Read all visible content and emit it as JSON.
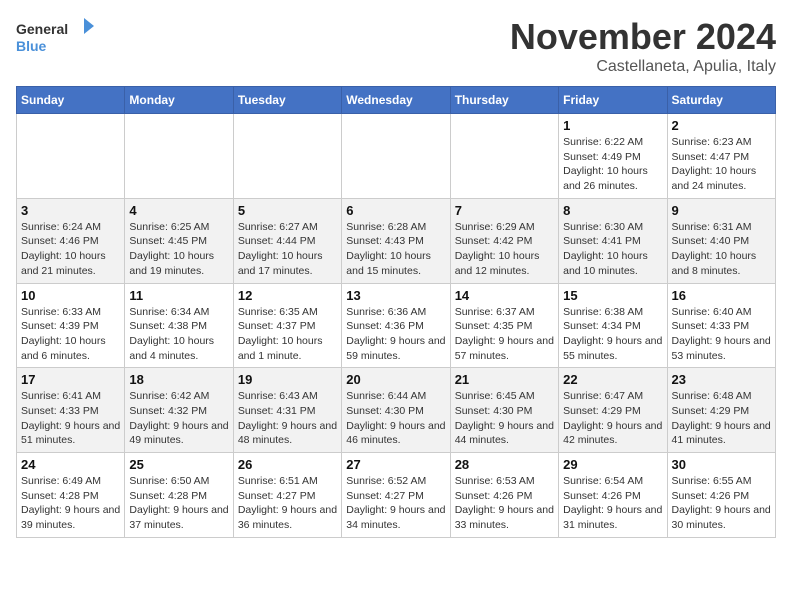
{
  "logo": {
    "general": "General",
    "blue": "Blue"
  },
  "title": "November 2024",
  "location": "Castellaneta, Apulia, Italy",
  "days_header": [
    "Sunday",
    "Monday",
    "Tuesday",
    "Wednesday",
    "Thursday",
    "Friday",
    "Saturday"
  ],
  "weeks": [
    [
      {
        "day": "",
        "info": ""
      },
      {
        "day": "",
        "info": ""
      },
      {
        "day": "",
        "info": ""
      },
      {
        "day": "",
        "info": ""
      },
      {
        "day": "",
        "info": ""
      },
      {
        "day": "1",
        "info": "Sunrise: 6:22 AM\nSunset: 4:49 PM\nDaylight: 10 hours and 26 minutes."
      },
      {
        "day": "2",
        "info": "Sunrise: 6:23 AM\nSunset: 4:47 PM\nDaylight: 10 hours and 24 minutes."
      }
    ],
    [
      {
        "day": "3",
        "info": "Sunrise: 6:24 AM\nSunset: 4:46 PM\nDaylight: 10 hours and 21 minutes."
      },
      {
        "day": "4",
        "info": "Sunrise: 6:25 AM\nSunset: 4:45 PM\nDaylight: 10 hours and 19 minutes."
      },
      {
        "day": "5",
        "info": "Sunrise: 6:27 AM\nSunset: 4:44 PM\nDaylight: 10 hours and 17 minutes."
      },
      {
        "day": "6",
        "info": "Sunrise: 6:28 AM\nSunset: 4:43 PM\nDaylight: 10 hours and 15 minutes."
      },
      {
        "day": "7",
        "info": "Sunrise: 6:29 AM\nSunset: 4:42 PM\nDaylight: 10 hours and 12 minutes."
      },
      {
        "day": "8",
        "info": "Sunrise: 6:30 AM\nSunset: 4:41 PM\nDaylight: 10 hours and 10 minutes."
      },
      {
        "day": "9",
        "info": "Sunrise: 6:31 AM\nSunset: 4:40 PM\nDaylight: 10 hours and 8 minutes."
      }
    ],
    [
      {
        "day": "10",
        "info": "Sunrise: 6:33 AM\nSunset: 4:39 PM\nDaylight: 10 hours and 6 minutes."
      },
      {
        "day": "11",
        "info": "Sunrise: 6:34 AM\nSunset: 4:38 PM\nDaylight: 10 hours and 4 minutes."
      },
      {
        "day": "12",
        "info": "Sunrise: 6:35 AM\nSunset: 4:37 PM\nDaylight: 10 hours and 1 minute."
      },
      {
        "day": "13",
        "info": "Sunrise: 6:36 AM\nSunset: 4:36 PM\nDaylight: 9 hours and 59 minutes."
      },
      {
        "day": "14",
        "info": "Sunrise: 6:37 AM\nSunset: 4:35 PM\nDaylight: 9 hours and 57 minutes."
      },
      {
        "day": "15",
        "info": "Sunrise: 6:38 AM\nSunset: 4:34 PM\nDaylight: 9 hours and 55 minutes."
      },
      {
        "day": "16",
        "info": "Sunrise: 6:40 AM\nSunset: 4:33 PM\nDaylight: 9 hours and 53 minutes."
      }
    ],
    [
      {
        "day": "17",
        "info": "Sunrise: 6:41 AM\nSunset: 4:33 PM\nDaylight: 9 hours and 51 minutes."
      },
      {
        "day": "18",
        "info": "Sunrise: 6:42 AM\nSunset: 4:32 PM\nDaylight: 9 hours and 49 minutes."
      },
      {
        "day": "19",
        "info": "Sunrise: 6:43 AM\nSunset: 4:31 PM\nDaylight: 9 hours and 48 minutes."
      },
      {
        "day": "20",
        "info": "Sunrise: 6:44 AM\nSunset: 4:30 PM\nDaylight: 9 hours and 46 minutes."
      },
      {
        "day": "21",
        "info": "Sunrise: 6:45 AM\nSunset: 4:30 PM\nDaylight: 9 hours and 44 minutes."
      },
      {
        "day": "22",
        "info": "Sunrise: 6:47 AM\nSunset: 4:29 PM\nDaylight: 9 hours and 42 minutes."
      },
      {
        "day": "23",
        "info": "Sunrise: 6:48 AM\nSunset: 4:29 PM\nDaylight: 9 hours and 41 minutes."
      }
    ],
    [
      {
        "day": "24",
        "info": "Sunrise: 6:49 AM\nSunset: 4:28 PM\nDaylight: 9 hours and 39 minutes."
      },
      {
        "day": "25",
        "info": "Sunrise: 6:50 AM\nSunset: 4:28 PM\nDaylight: 9 hours and 37 minutes."
      },
      {
        "day": "26",
        "info": "Sunrise: 6:51 AM\nSunset: 4:27 PM\nDaylight: 9 hours and 36 minutes."
      },
      {
        "day": "27",
        "info": "Sunrise: 6:52 AM\nSunset: 4:27 PM\nDaylight: 9 hours and 34 minutes."
      },
      {
        "day": "28",
        "info": "Sunrise: 6:53 AM\nSunset: 4:26 PM\nDaylight: 9 hours and 33 minutes."
      },
      {
        "day": "29",
        "info": "Sunrise: 6:54 AM\nSunset: 4:26 PM\nDaylight: 9 hours and 31 minutes."
      },
      {
        "day": "30",
        "info": "Sunrise: 6:55 AM\nSunset: 4:26 PM\nDaylight: 9 hours and 30 minutes."
      }
    ]
  ]
}
